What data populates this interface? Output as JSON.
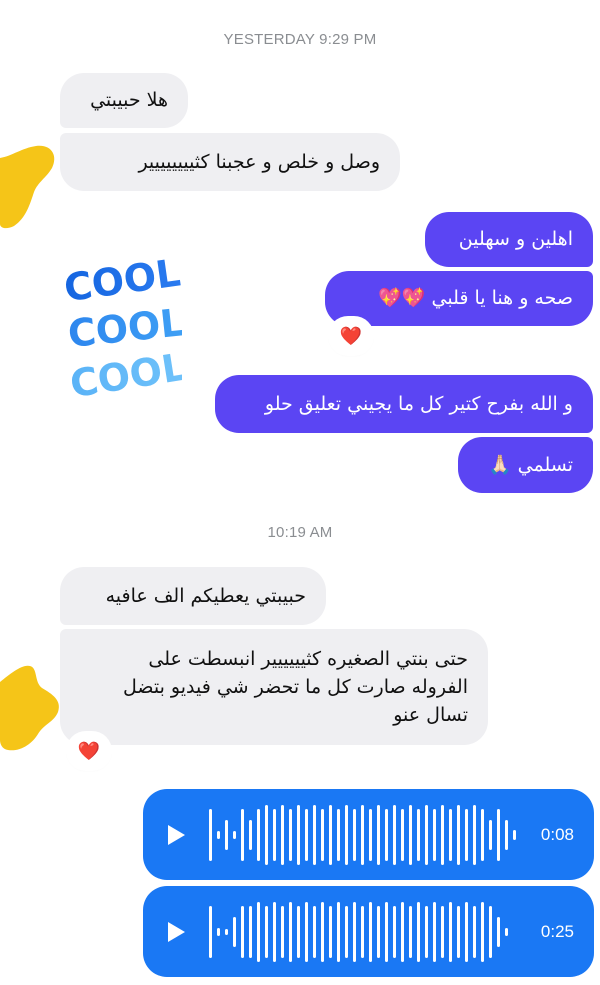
{
  "colors": {
    "incoming_bubble": "#efeff2",
    "outgoing_bubble": "#5b45f3",
    "voice_bubble": "#1a78f4",
    "timestamp": "#8a8d91",
    "redaction_blob": "#f5c518"
  },
  "timestamps": {
    "first": "YESTERDAY 9:29 PM",
    "second": "10:19 AM"
  },
  "messages": {
    "m1": "هلا حبيبتي",
    "m2": "وصل و خلص و عجبنا كثيييييييير",
    "m3": "اهلين و سهلين",
    "m4": "صحه و هنا يا قلبي 💖💖",
    "m5": "و الله بفرح كتير كل ما يجيني تعليق حلو",
    "m6": "تسلمي 🙏🏻",
    "m7": "حبيبتي يعطيكم الف عافيه",
    "m8_line1": "حتى بنتي الصغيره كثيييييير انبسطت على",
    "m8_line2": "الفروله صارت كل ما تحضر شي فيديو بتضل",
    "m8_line3": "تسال عنو"
  },
  "reactions": {
    "r1": "❤️",
    "r2": "❤️"
  },
  "sticker": {
    "word": "COOL",
    "icon": "cool-sticker-icon"
  },
  "voice_messages": [
    {
      "duration": "0:08"
    },
    {
      "duration": "0:25"
    }
  ]
}
